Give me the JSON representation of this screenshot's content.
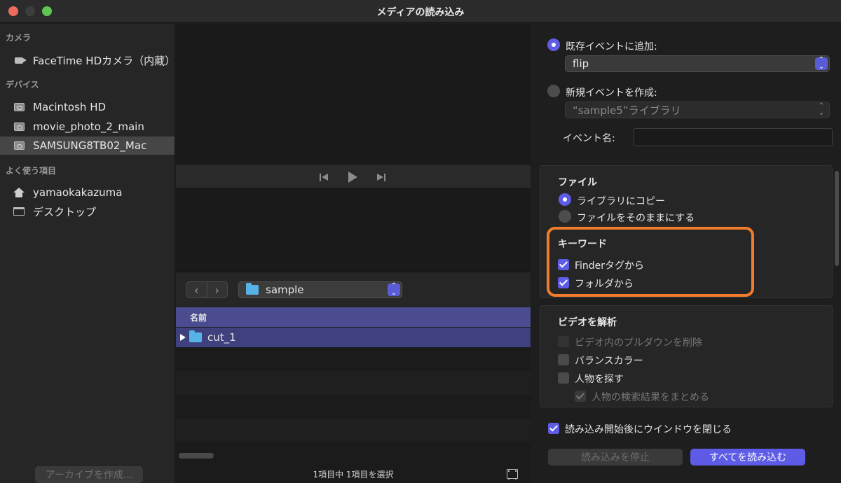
{
  "window": {
    "title": "メディアの読み込み"
  },
  "sidebar": {
    "sections": {
      "camera": "カメラ",
      "devices": "デバイス",
      "favorites": "よく使う項目"
    },
    "items": [
      {
        "label": "FaceTime HDカメラ（内蔵）",
        "icon": "camera-icon"
      },
      {
        "label": "Macintosh HD",
        "icon": "disk-icon"
      },
      {
        "label": "movie_photo_2_main",
        "icon": "disk-icon"
      },
      {
        "label": "SAMSUNG8TB02_Mac",
        "icon": "disk-icon",
        "selected": true
      },
      {
        "label": "yamaokakazuma",
        "icon": "house-icon"
      },
      {
        "label": "デスクトップ",
        "icon": "desktop-icon"
      }
    ],
    "archive_button": "アーカイブを作成..."
  },
  "browser": {
    "nav_back": "‹",
    "nav_forward": "›",
    "folder": "sample",
    "column_name": "名前",
    "rows": [
      {
        "name": "cut_1"
      }
    ],
    "status": "1項目中 1項目を選択"
  },
  "options": {
    "add_existing_label": "既存イベントに追加:",
    "existing_event_value": "flip",
    "new_event_label": "新規イベントを作成:",
    "new_event_library": "“sample5”ライブラリ",
    "event_name_label": "イベント名:",
    "event_name_value": "",
    "file_group": {
      "title": "ファイル",
      "copy_to_library": "ライブラリにコピー",
      "leave_in_place": "ファイルをそのままにする"
    },
    "keyword_group": {
      "title": "キーワード",
      "from_finder_tags": "Finderタグから",
      "from_folders": "フォルダから"
    },
    "video_group": {
      "title": "ビデオを解析",
      "remove_pulldown": "ビデオ内のプルダウンを削除",
      "balance_color": "バランスカラー",
      "find_people": "人物を探す",
      "consolidate_people": "人物の検索結果をまとめる"
    },
    "close_window_label": "読み込み開始後にウインドウを閉じる",
    "stop_import_button": "読み込みを停止",
    "import_all_button": "すべてを読み込む"
  },
  "colors": {
    "accent": "#5e5ce6",
    "highlight": "#f07c2c",
    "folder": "#57b2e8"
  }
}
